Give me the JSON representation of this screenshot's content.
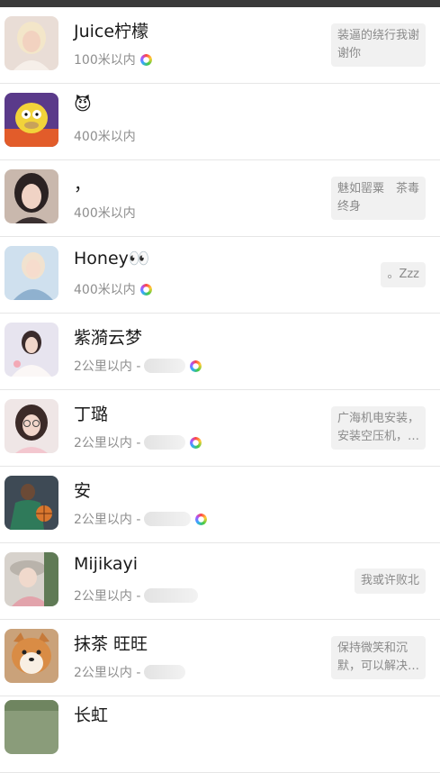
{
  "contacts": [
    {
      "name": "Juice柠檬",
      "distance": "100米以内",
      "suffix": "",
      "has_ring": true,
      "bio": [
        "装逼的绕行我谢",
        "谢你"
      ],
      "avatar_icon": "avatar-girl-blonde"
    },
    {
      "name": "😈",
      "distance": "400米以内",
      "suffix": "",
      "has_ring": false,
      "bio": [],
      "avatar_icon": "avatar-cartoon"
    },
    {
      "name": "，",
      "distance": "400米以内",
      "suffix": "",
      "has_ring": false,
      "bio": [
        "魅如罂粟　茶毒",
        "终身"
      ],
      "avatar_icon": "avatar-girl-dark-hair"
    },
    {
      "name": "Honey👀",
      "distance": "400米以内",
      "suffix": "",
      "has_ring": true,
      "bio": [
        "。Zzz"
      ],
      "avatar_icon": "avatar-girl-light"
    },
    {
      "name": "紫漪云梦",
      "distance": "2公里以内 -",
      "suffix": "",
      "has_ring": true,
      "bio": [],
      "avatar_icon": "avatar-girl-white-dress"
    },
    {
      "name": "丁璐",
      "distance": "2公里以内 -",
      "suffix": "",
      "has_ring": true,
      "bio": [
        "广海机电安装，",
        "安装空压机，…"
      ],
      "avatar_icon": "avatar-girl-glasses"
    },
    {
      "name": "安",
      "distance": "2公里以内 -",
      "suffix": "",
      "has_ring": true,
      "bio": [],
      "avatar_icon": "avatar-basketball"
    },
    {
      "name": "Mijikayi",
      "distance": "2公里以内 -",
      "suffix": "",
      "has_ring": true,
      "bio": [
        "我或许败北"
      ],
      "avatar_icon": "avatar-girl-hat"
    },
    {
      "name": "抹茶 旺旺",
      "distance": "2公里以内 -",
      "suffix": "",
      "has_ring": false,
      "bio": [
        "保持微笑和沉",
        "默，可以解决…"
      ],
      "avatar_icon": "avatar-shiba-dog"
    },
    {
      "name": "长虹",
      "distance": "",
      "suffix": "",
      "has_ring": false,
      "bio": [],
      "avatar_icon": "avatar-landscape"
    }
  ]
}
